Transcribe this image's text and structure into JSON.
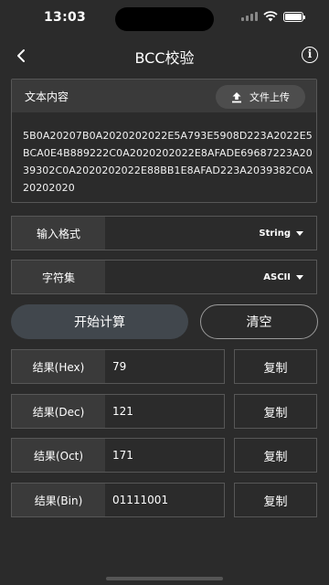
{
  "status": {
    "time": "13:03"
  },
  "nav": {
    "title": "BCC校验"
  },
  "input_card": {
    "label": "文本内容",
    "upload_label": "文件上传",
    "content": "5B0A20207B0A2020202022E5A793E5908D223A2022E5BCA0E4B889222C0A2020202022E8AFADE69687223A2039302C0A2020202022E88BB1E8AFAD223A2039382C0A20202020"
  },
  "input_format": {
    "label": "输入格式",
    "value": "String"
  },
  "charset": {
    "label": "字符集",
    "value": "ASCII"
  },
  "buttons": {
    "start": "开始计算",
    "clear": "清空"
  },
  "results": [
    {
      "label": "结果(Hex)",
      "value": "79",
      "copy": "复制"
    },
    {
      "label": "结果(Dec)",
      "value": "121",
      "copy": "复制"
    },
    {
      "label": "结果(Oct)",
      "value": "171",
      "copy": "复制"
    },
    {
      "label": "结果(Bin)",
      "value": "01111001",
      "copy": "复制"
    }
  ]
}
